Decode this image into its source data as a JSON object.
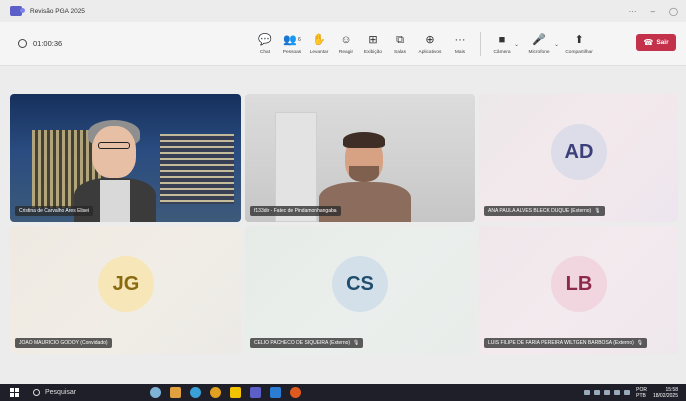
{
  "window": {
    "title": "Revisão PGA 2025",
    "controls": {
      "more": "···",
      "minimize": "–",
      "restore": "◯"
    }
  },
  "toolbar": {
    "timer": "01:00:36",
    "tools": [
      {
        "label": "Chat",
        "icon": "chat-icon",
        "glyph": "💬"
      },
      {
        "label": "Pessoas",
        "icon": "people-icon",
        "glyph": "👥",
        "badge": "6"
      },
      {
        "label": "Levantar",
        "icon": "raise-hand-icon",
        "glyph": "✋"
      },
      {
        "label": "Reagir",
        "icon": "react-icon",
        "glyph": "☺"
      },
      {
        "label": "Exibição",
        "icon": "view-icon",
        "glyph": "⊞"
      },
      {
        "label": "Salas",
        "icon": "rooms-icon",
        "glyph": "⧉"
      },
      {
        "label": "Aplicativos",
        "icon": "apps-icon",
        "glyph": "⊕"
      },
      {
        "label": "Mais",
        "icon": "more-icon",
        "glyph": "···"
      }
    ],
    "devices": [
      {
        "label": "Câmera",
        "icon": "camera-icon",
        "glyph": "■"
      },
      {
        "label": "Microfone",
        "icon": "microphone-icon",
        "glyph": "🎤"
      },
      {
        "label": "Compartilhar",
        "icon": "share-icon",
        "glyph": "⬆"
      }
    ],
    "leave_label": "Sair"
  },
  "participants": [
    {
      "name": "Cristina de Carvalho Ares Elisei",
      "type": "video"
    },
    {
      "name": "f133dir - Fatec de Pindamonhangaba",
      "type": "video"
    },
    {
      "name": "ANA PAULA ALVES BLECK DUQUE (Externo)",
      "initials": "AD",
      "muted": true,
      "avatar_bg": "#dcdde8",
      "avatar_fg": "#3d3f7a"
    },
    {
      "name": "JOAO MAURICIO GODOY (Convidado)",
      "initials": "JG",
      "muted": false,
      "avatar_bg": "#f7e6b8",
      "avatar_fg": "#8a6a10"
    },
    {
      "name": "CELIO PACHECO DE SIQUEIRA (Externo)",
      "initials": "CS",
      "muted": true,
      "avatar_bg": "#d3e0ea",
      "avatar_fg": "#1f4e6e"
    },
    {
      "name": "LUIS FILIPE DE FARIA PEREIRA WILTGEN BARBOSA (Externo)",
      "initials": "LB",
      "muted": true,
      "avatar_bg": "#f1d6df",
      "avatar_fg": "#8b2a4a"
    }
  ],
  "taskbar": {
    "search_label": "Pesquisar",
    "lang": "POR",
    "lang2": "PTB",
    "time": "15:58",
    "date": "18/02/2025"
  },
  "colors": {
    "leave": "#c4314b",
    "accent": "#5b5fc7"
  }
}
